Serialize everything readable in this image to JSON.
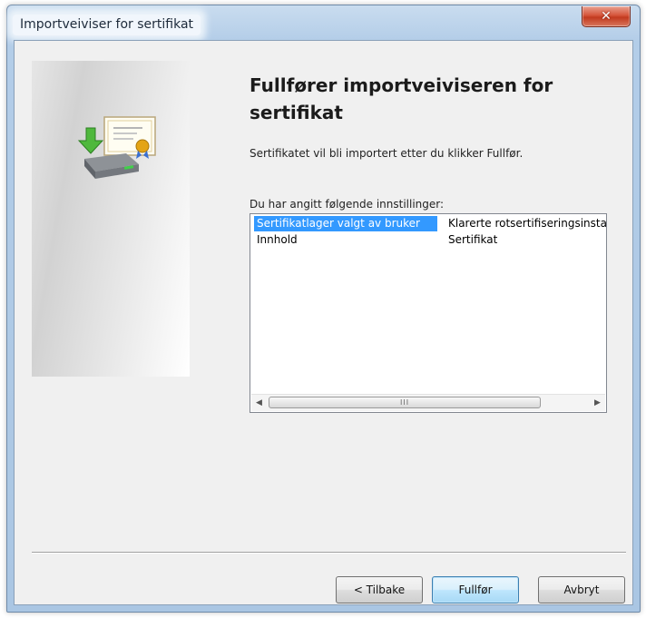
{
  "window": {
    "title": "Importveiviser for sertifikat",
    "close_glyph": "✕"
  },
  "wizard": {
    "heading": "Fullfører importveiviseren for sertifikat",
    "description": "Sertifikatet vil bli importert etter du klikker Fullfør.",
    "settings_label": "Du har angitt følgende innstillinger:",
    "settings": [
      {
        "name": "Sertifikatlager valgt av bruker",
        "value": "Klarerte rotsertifiseringsinstanser",
        "selected": true
      },
      {
        "name": "Innhold",
        "value": "Sertifikat",
        "selected": false
      }
    ],
    "scrollbar": {
      "left_arrow": "◀",
      "right_arrow": "▶",
      "grip": "III"
    }
  },
  "buttons": {
    "back": "< Tilbake",
    "finish": "Fullfør",
    "cancel": "Avbryt"
  },
  "icons": [
    "certificate-import-icon",
    "close-icon",
    "scroll-left-icon",
    "scroll-right-icon"
  ],
  "colors": {
    "selection": "#3399ff",
    "close_button": "#c7432a",
    "title_bar": "#b3cde8"
  }
}
